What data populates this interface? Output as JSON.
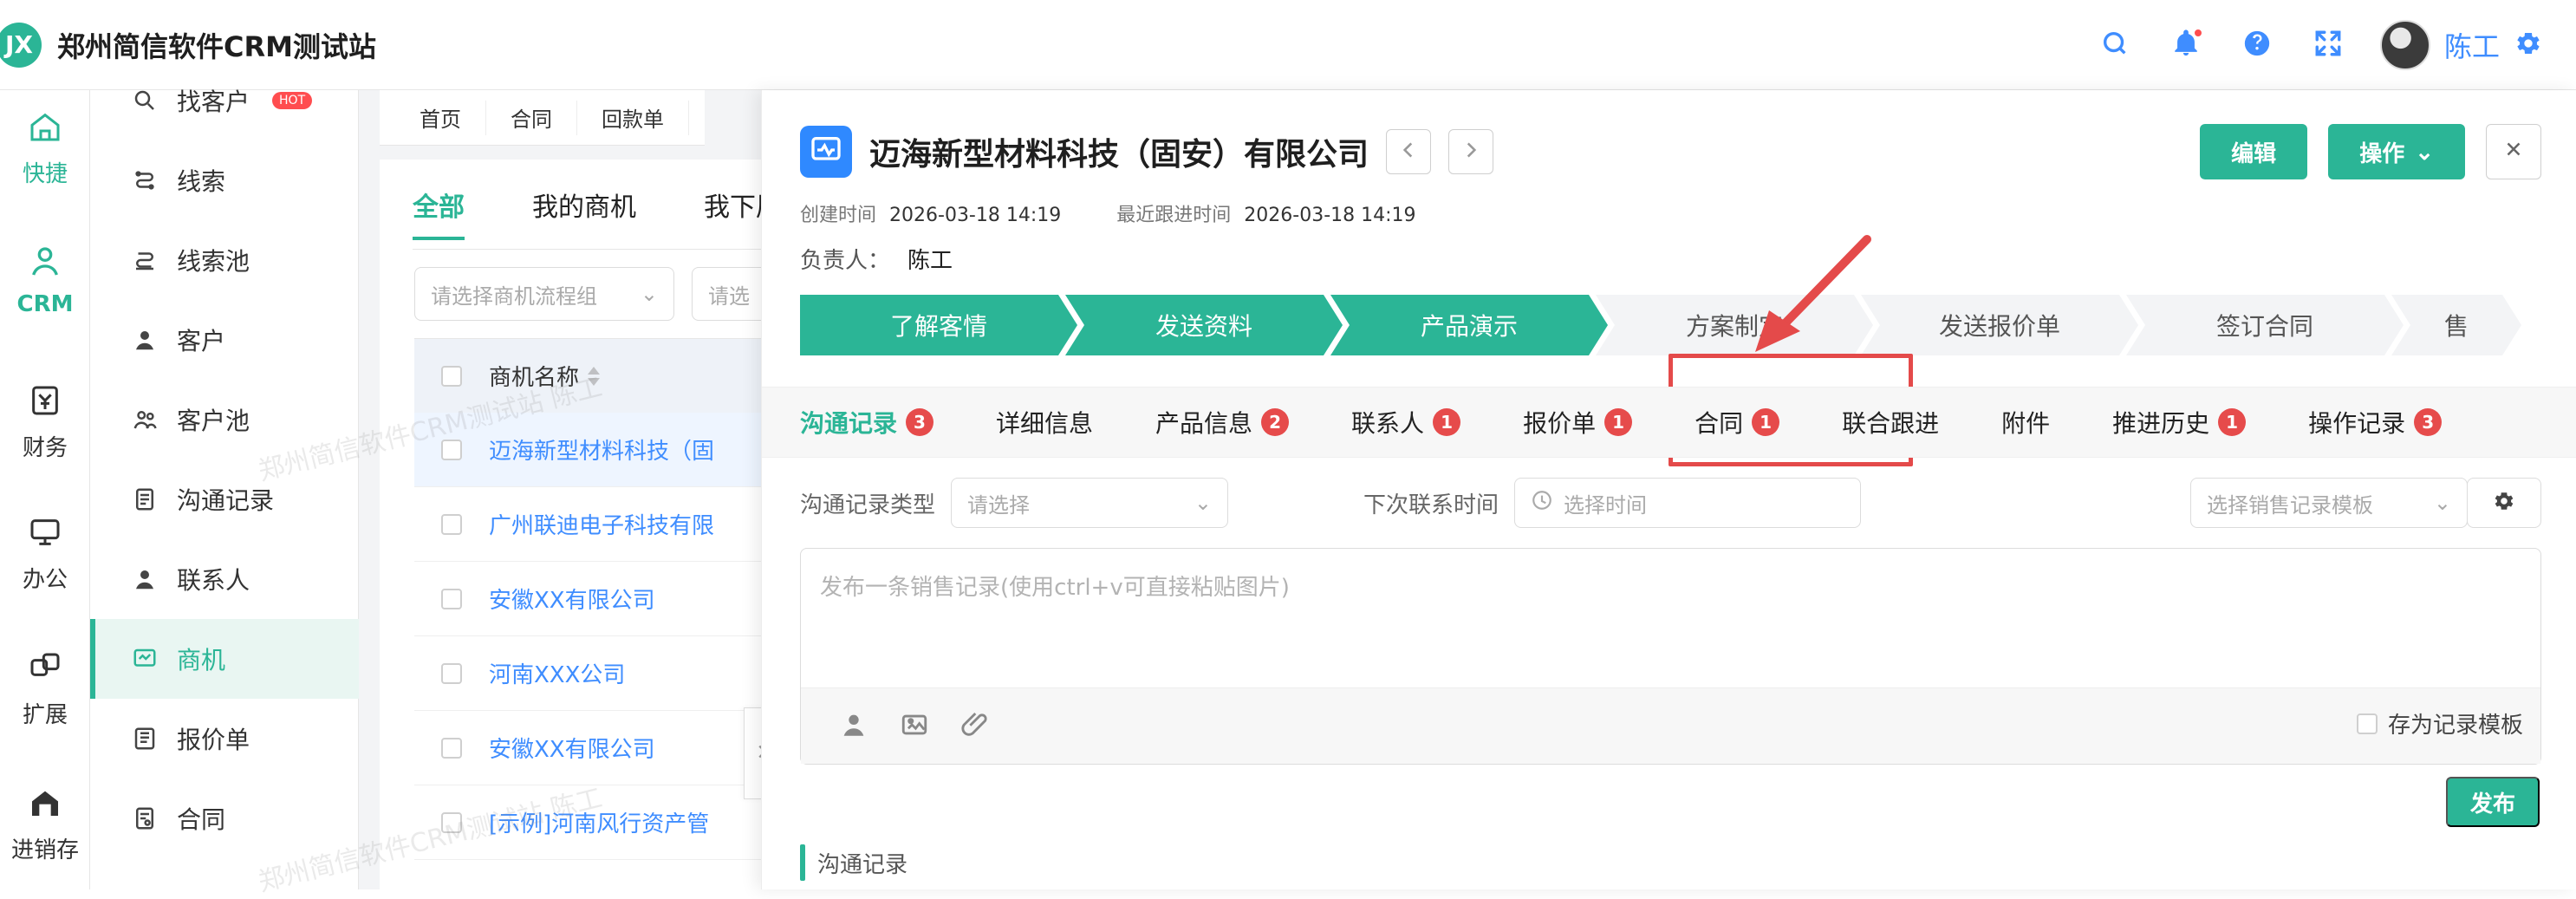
{
  "app": {
    "logo_text": "JX",
    "title": "郑州简信软件CRM测试站",
    "user_name": "陈工",
    "watermark": "郑州简信软件CRM测试站 陈工"
  },
  "rail": [
    {
      "label": "快捷",
      "icon": "home-icon"
    },
    {
      "label": "CRM",
      "icon": "crm-icon",
      "active": true
    },
    {
      "label": "财务",
      "icon": "finance-icon"
    },
    {
      "label": "办公",
      "icon": "monitor-icon"
    },
    {
      "label": "扩展",
      "icon": "extend-icon"
    },
    {
      "label": "进销存",
      "icon": "warehouse-icon"
    }
  ],
  "menu": [
    {
      "label": "找客户",
      "icon": "find-customer-icon",
      "hot": "HOT"
    },
    {
      "label": "线索",
      "icon": "lead-icon"
    },
    {
      "label": "线索池",
      "icon": "lead-pool-icon"
    },
    {
      "label": "客户",
      "icon": "customer-icon"
    },
    {
      "label": "客户池",
      "icon": "customer-pool-icon"
    },
    {
      "label": "沟通记录",
      "icon": "communication-icon"
    },
    {
      "label": "联系人",
      "icon": "contact-icon"
    },
    {
      "label": "商机",
      "icon": "opportunity-icon",
      "active": true
    },
    {
      "label": "报价单",
      "icon": "quote-icon"
    },
    {
      "label": "合同",
      "icon": "contract-icon"
    }
  ],
  "main": {
    "crumbs": [
      "首页",
      "合同",
      "回款单"
    ],
    "tabs": [
      "全部",
      "我的商机",
      "我下属"
    ],
    "filters": {
      "pipeline_placeholder": "请选择商机流程组",
      "second_placeholder": "请选"
    },
    "table": {
      "header": "商机名称",
      "rows": [
        "迈海新型材料科技（固",
        "广州联迪电子科技有限",
        "安徽XX有限公司",
        "河南XXX公司",
        "安徽XX有限公司",
        "[示例]河南风行资产管"
      ]
    }
  },
  "drawer": {
    "title": "迈海新型材料科技（固安）有限公司",
    "buttons": {
      "edit": "编辑",
      "operate": "操作"
    },
    "created_label": "创建时间",
    "created": "2026-03-18 14:19",
    "last_follow_label": "最近跟进时间",
    "last_follow": "2026-03-18 14:19",
    "owner_label": "负责人：",
    "owner": "陈工",
    "stages": [
      {
        "label": "了解客情",
        "status": "done"
      },
      {
        "label": "发送资料",
        "status": "done"
      },
      {
        "label": "产品演示",
        "status": "done"
      },
      {
        "label": "方案制定",
        "status": "todo"
      },
      {
        "label": "发送报价单",
        "status": "todo"
      },
      {
        "label": "签订合同",
        "status": "todo"
      },
      {
        "label": "售",
        "status": "todo"
      }
    ],
    "subtabs": [
      {
        "label": "沟通记录",
        "badge": "3",
        "active": true
      },
      {
        "label": "详细信息",
        "badge": null
      },
      {
        "label": "产品信息",
        "badge": "2"
      },
      {
        "label": "联系人",
        "badge": "1"
      },
      {
        "label": "报价单",
        "badge": "1"
      },
      {
        "label": "合同",
        "badge": "1"
      },
      {
        "label": "联合跟进",
        "badge": null
      },
      {
        "label": "附件",
        "badge": null
      },
      {
        "label": "推进历史",
        "badge": "1"
      },
      {
        "label": "操作记录",
        "badge": "3"
      }
    ],
    "record_type_label": "沟通记录类型",
    "record_type_placeholder": "请选择",
    "next_contact_label": "下次联系时间",
    "next_contact_placeholder": "选择时间",
    "template_placeholder": "选择销售记录模板",
    "editor_placeholder": "发布一条销售记录(使用ctrl+v可直接粘贴图片)",
    "save_template_label": "存为记录模板",
    "publish_label": "发布",
    "section_title": "沟通记录"
  }
}
